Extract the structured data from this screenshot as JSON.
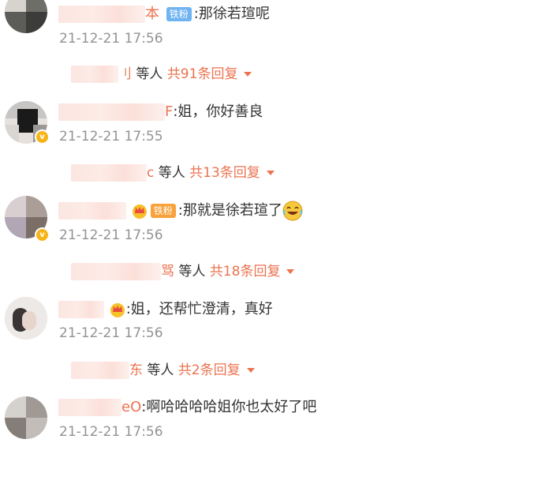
{
  "comments": [
    {
      "name_visible": "本",
      "fan_badge": "铁粉",
      "text": ":那徐若瑄呢",
      "time": "21-12-21 17:56",
      "reply_tail": "刂",
      "reply_who": "等人",
      "reply_count": "共91条回复"
    },
    {
      "name_visible": "F",
      "text": ":姐，你好善良",
      "time": "21-12-21 17:55",
      "reply_tail": "c",
      "reply_who": "等人",
      "reply_count": "共13条回复"
    },
    {
      "name_visible": "",
      "fan_badge": "铁粉",
      "text": ":那就是徐若瑄了",
      "time": "21-12-21 17:56",
      "reply_tail": "骂",
      "reply_who": "等人",
      "reply_count": "共18条回复"
    },
    {
      "name_visible": "",
      "text": ":姐，还帮忙澄清，真好",
      "time": "21-12-21 17:56",
      "reply_tail": "东",
      "reply_who": "等人",
      "reply_count": "共2条回复"
    },
    {
      "name_visible": "eO",
      "text": ":啊哈哈哈哈姐你也太好了吧",
      "time": "21-12-21 17:56"
    }
  ],
  "colors": {
    "accent": "#eb7350",
    "time": "#939393",
    "fan_blue": "#6fb3f0",
    "vip": "#f6b417"
  },
  "icons": [
    "dropdown-arrow-icon",
    "crown-icon",
    "laughing-emoji-icon",
    "verified-badge-icon"
  ]
}
